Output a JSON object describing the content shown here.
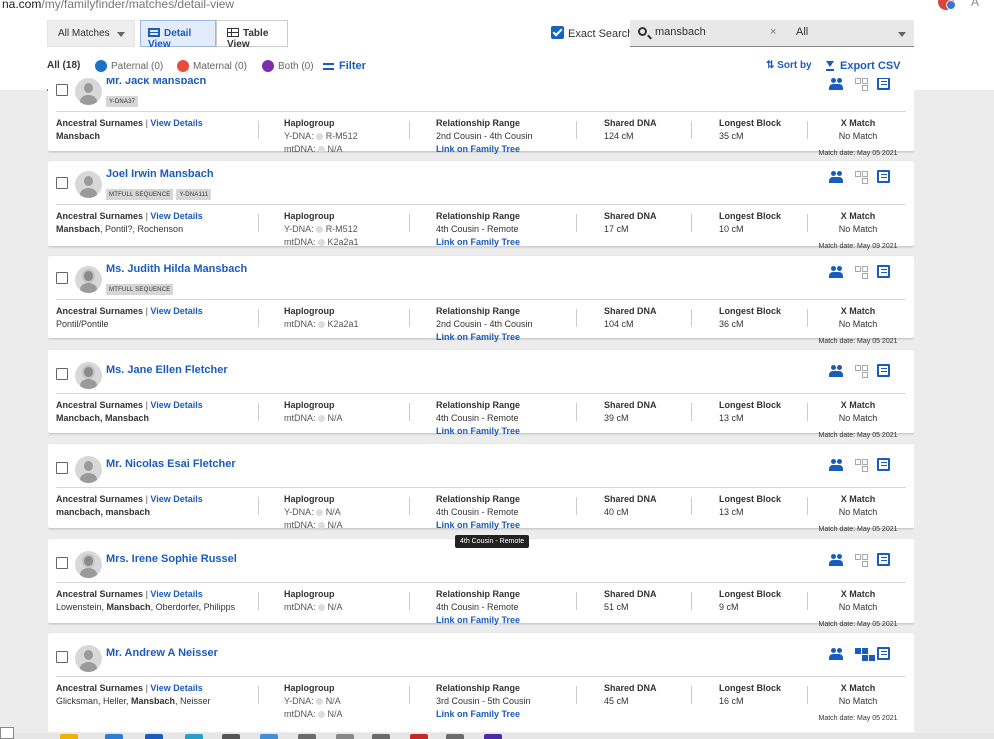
{
  "browser": {
    "url_host": "na.com",
    "url_path": "/my/familyfinder/matches/detail-view"
  },
  "toolbar": {
    "matches_select": "All Matches",
    "detail_view_label": "Detail View",
    "table_view_label": "Table View",
    "exact_search_label": "Exact Search",
    "exact_search_checked": true,
    "search_value": "mansbach",
    "search_clear": "×",
    "filter_select": "All"
  },
  "tabs": {
    "all": "All (18)",
    "paternal": "Paternal (0)",
    "maternal": "Maternal (0)",
    "both": "Both (0)",
    "filter": "Filter",
    "sort_by": "Sort by",
    "export": "Export CSV",
    "colors": {
      "paternal": "#1a73c8",
      "maternal": "#e94b3c",
      "both": "#7b2fa8"
    }
  },
  "labels": {
    "ancestral_surnames": "Ancestral Surnames",
    "view_details": "View Details",
    "haplogroup": "Haplogroup",
    "relationship_range": "Relationship Range",
    "shared_dna": "Shared DNA",
    "longest_block": "Longest Block",
    "x_match": "X Match",
    "link_family_tree": "Link on Family Tree",
    "ydna_prefix": "Y-DNA:",
    "mtdna_prefix": "mtDNA:"
  },
  "matches": [
    {
      "name": "Mr. Jack Mansbach",
      "gender": "m",
      "badges": [
        "Y-DNA37"
      ],
      "surnames": [
        {
          "text": "Mansbach",
          "bold": true
        }
      ],
      "ydna": "R-M512",
      "mtdna": "N/A",
      "relationship": "2nd Cousin - 4th Cousin",
      "shared_dna": "124 cM",
      "longest_block": "35 cM",
      "x_match": "No Match",
      "match_date": "Match date: May 05 2021",
      "tree_linked": false
    },
    {
      "name": "Joel Irwin Mansbach",
      "gender": "m",
      "badges": [
        "MTFULL SEQUENCE",
        "Y-DNA111"
      ],
      "surnames": [
        {
          "text": "Mansbach",
          "bold": true
        },
        {
          "text": ", Pontil?, Rochenson",
          "bold": false
        }
      ],
      "ydna": "R-M512",
      "mtdna": "K2a2a1",
      "relationship": "4th Cousin - Remote",
      "shared_dna": "17 cM",
      "longest_block": "10 cM",
      "x_match": "No Match",
      "match_date": "Match date: May 09 2021",
      "tree_linked": false
    },
    {
      "name": "Ms. Judith Hilda Mansbach",
      "gender": "f",
      "badges": [
        "MTFULL SEQUENCE"
      ],
      "surnames": [
        {
          "text": "Pontil/Pontile",
          "bold": false
        }
      ],
      "ydna": null,
      "mtdna": "K2a2a1",
      "relationship": "2nd Cousin - 4th Cousin",
      "shared_dna": "104 cM",
      "longest_block": "36 cM",
      "x_match": "No Match",
      "match_date": "Match date: May 05 2021",
      "tree_linked": false
    },
    {
      "name": "Ms. Jane Ellen Fletcher",
      "gender": "f",
      "badges": [],
      "surnames": [
        {
          "text": "Mancbach, Mansbach",
          "bold": true
        }
      ],
      "ydna": null,
      "mtdna": "N/A",
      "relationship": "4th Cousin - Remote",
      "shared_dna": "39 cM",
      "longest_block": "13 cM",
      "x_match": "No Match",
      "match_date": "Match date: May 05 2021",
      "tree_linked": false
    },
    {
      "name": "Mr. Nicolas Esai Fletcher",
      "gender": "m",
      "badges": [],
      "surnames": [
        {
          "text": "mancbach, mansbach",
          "bold": true
        }
      ],
      "ydna": "N/A",
      "mtdna": "N/A",
      "relationship": "4th Cousin - Remote",
      "shared_dna": "40 cM",
      "longest_block": "13 cM",
      "x_match": "No Match",
      "match_date": "Match date: May 05 2021",
      "tree_linked": false
    },
    {
      "name": "Mrs. Irene Sophie Russel",
      "gender": "f",
      "badges": [],
      "surnames": [
        {
          "text": "Lowenstein, ",
          "bold": false
        },
        {
          "text": "Mansbach",
          "bold": true
        },
        {
          "text": ", Oberdorfer, Philipps",
          "bold": false
        }
      ],
      "ydna": null,
      "mtdna": "N/A",
      "relationship": "4th Cousin - Remote",
      "shared_dna": "51 cM",
      "longest_block": "9 cM",
      "x_match": "No Match",
      "match_date": "Match date: May 05 2021",
      "tree_linked": false
    },
    {
      "name": "Mr. Andrew A Neisser",
      "gender": "m",
      "badges": [],
      "surnames": [
        {
          "text": "Glicksman, Heller, ",
          "bold": false
        },
        {
          "text": "Mansbach",
          "bold": true
        },
        {
          "text": ", Neisser",
          "bold": false
        }
      ],
      "ydna": "N/A",
      "mtdna": "N/A",
      "relationship": "3rd Cousin - 5th Cousin",
      "shared_dna": "45 cM",
      "longest_block": "16 cM",
      "x_match": "No Match",
      "match_date": "Match date: May 05 2021",
      "tree_linked": true
    }
  ],
  "tooltip": "4th Cousin - Remote"
}
